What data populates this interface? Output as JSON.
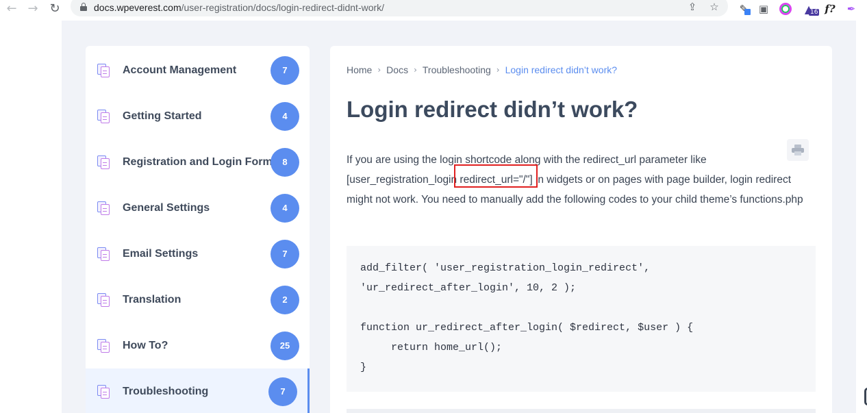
{
  "browser": {
    "url_host": "docs.wpeverest.com",
    "url_path": "/user-registration/docs/login-redirect-didnt-work/",
    "extension_badge": "16",
    "extension_fx": "f?"
  },
  "sidebar": {
    "items": [
      {
        "label": "Account Management",
        "count": "7"
      },
      {
        "label": "Getting Started",
        "count": "4"
      },
      {
        "label": "Registration and Login Form",
        "count": "8"
      },
      {
        "label": "General Settings",
        "count": "4"
      },
      {
        "label": "Email Settings",
        "count": "7"
      },
      {
        "label": "Translation",
        "count": "2"
      },
      {
        "label": "How To?",
        "count": "25"
      },
      {
        "label": "Troubleshooting",
        "count": "7"
      }
    ]
  },
  "breadcrumb": {
    "home": "Home",
    "docs": "Docs",
    "section": "Troubleshooting",
    "current": "Login redirect didn’t work?"
  },
  "article": {
    "title": "Login redirect didn’t work?",
    "paragraph": "If you are using the login shortcode along with the redirect_url parameter like [user_registration_login redirect_url=\"/\"] in widgets or on pages with page builder, login redirect might not work. You need to manually add the following codes to your child theme’s functions.php",
    "code": "add_filter( 'user_registration_login_redirect',\n'ur_redirect_after_login', 10, 2 );\n\nfunction ur_redirect_after_login( $redirect, $user ) {\n     return home_url();\n}"
  },
  "colors": {
    "accent": "#5b8def",
    "highlight_box": "#e02020",
    "page_bg": "#f1f3f8"
  }
}
